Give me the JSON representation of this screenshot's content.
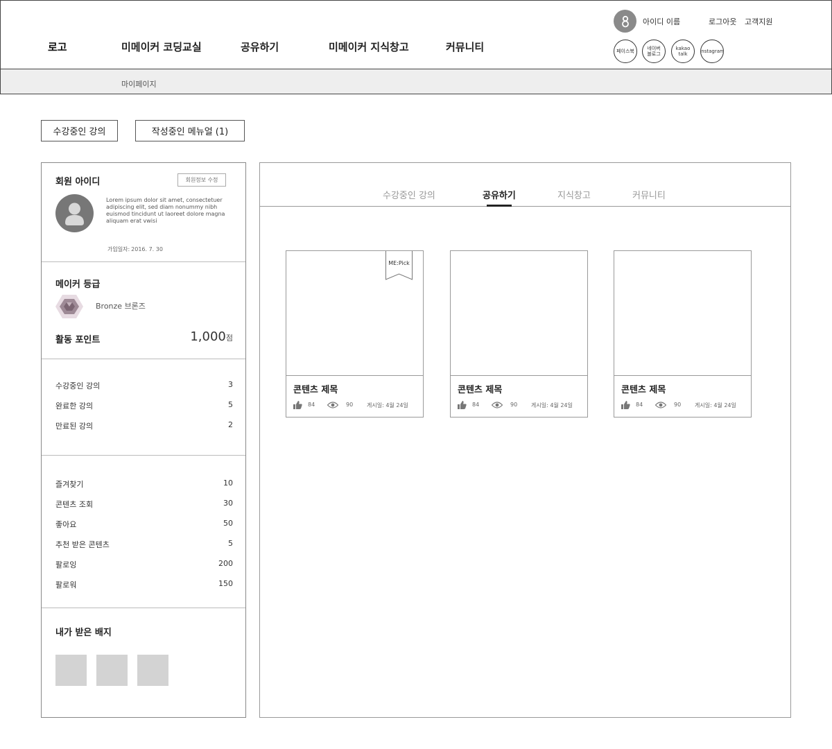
{
  "header": {
    "logo": "로고",
    "nav": [
      "미메이커 코딩교실",
      "공유하기",
      "미메이커 지식창고",
      "커뮤니티"
    ],
    "user_name": "아이디 이름",
    "logout": "로그아웃",
    "support": "고객지원",
    "sns": [
      {
        "label": "페이스북",
        "icon": "facebook-icon"
      },
      {
        "label": "네이버\n블로그",
        "icon": "naver-blog-icon"
      },
      {
        "label": "kakao\ntalk",
        "icon": "kakaotalk-icon"
      },
      {
        "label": "Instagram",
        "icon": "instagram-icon"
      }
    ]
  },
  "subnav": {
    "label": "마이페이지"
  },
  "top_buttons": [
    "수강중인 강의",
    "작성중인 메뉴얼 (1)"
  ],
  "profile": {
    "title": "회원 아이디",
    "edit_label": "회원정보 수정",
    "description": "Lorem ipsum dolor sit amet, consectetuer adipiscing elit, sed diam nonummy nibh euismod tincidunt ut laoreet dolore magna aliquam erat vwisi",
    "join_label": "가입일자:",
    "join_date": "2016. 7. 30"
  },
  "grade": {
    "title": "메이커 등급",
    "name": "Bronze 브론즈",
    "icon": "bronze-hexagon-icon",
    "points_label": "활동 포인트",
    "points_value": "1,000",
    "points_unit": "점"
  },
  "courses": [
    {
      "label": "수강중인 강의",
      "value": "3"
    },
    {
      "label": "완료한 강의",
      "value": "5"
    },
    {
      "label": "만료된 강의",
      "value": "2"
    }
  ],
  "activity": [
    {
      "label": "즐겨찾기",
      "value": "10"
    },
    {
      "label": "콘텐츠 조회",
      "value": "30"
    },
    {
      "label": "좋아요",
      "value": "50"
    },
    {
      "label": "추천 받은 콘텐츠",
      "value": "5"
    },
    {
      "label": "팔로잉",
      "value": "200"
    },
    {
      "label": "팔로워",
      "value": "150"
    }
  ],
  "badges": {
    "title": "내가 받은 배지",
    "count": 3
  },
  "tabs": [
    {
      "label": "수강중인 강의",
      "active": false
    },
    {
      "label": "공유하기",
      "active": true
    },
    {
      "label": "지식창고",
      "active": false
    },
    {
      "label": "커뮤니티",
      "active": false
    }
  ],
  "cards": [
    {
      "title": "콘텐츠 제목",
      "likes": "84",
      "views": "90",
      "date_label": "게시일:",
      "date": "4월 24일",
      "pick": "ME:Pick"
    },
    {
      "title": "콘텐츠 제목",
      "likes": "84",
      "views": "90",
      "date_label": "게시일:",
      "date": "4월 24일",
      "pick": ""
    },
    {
      "title": "콘텐츠 제목",
      "likes": "84",
      "views": "90",
      "date_label": "게시일:",
      "date": "4월 24일",
      "pick": ""
    }
  ],
  "colors": {
    "avatar": "#8a8a8a",
    "badge_placeholder": "#d3d3d3",
    "subbar": "#eeeeee",
    "active_tab": "#222222",
    "inactive_tab": "#999999",
    "bronze": "#9e8a96"
  }
}
